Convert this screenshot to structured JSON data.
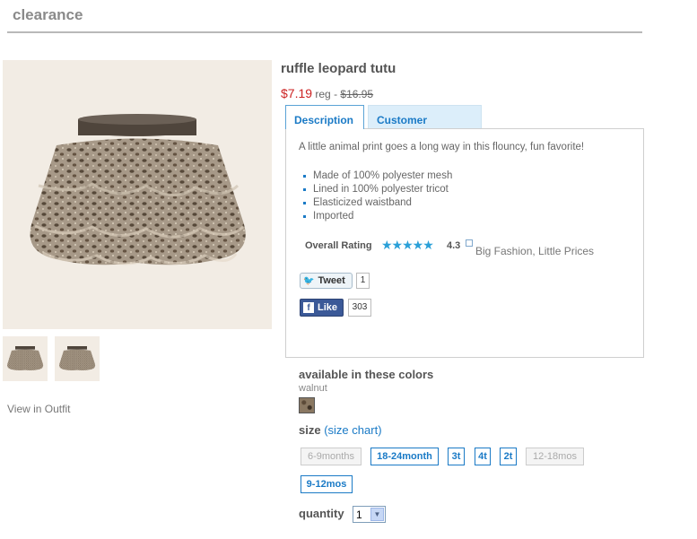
{
  "header": {
    "section_title": "clearance"
  },
  "product": {
    "title": "ruffle leopard tutu",
    "sale_price": "$7.19",
    "reg_label": "reg - ",
    "reg_price": "$16.95"
  },
  "gallery": {
    "view_outfit": "View in Outfit"
  },
  "tabs": [
    {
      "label": "Description",
      "active": true
    },
    {
      "label": "Customer Reviews",
      "active": false
    }
  ],
  "description": {
    "text": "A little animal print goes a long way in this flouncy, fun favorite!",
    "features": [
      "Made of 100% polyester mesh",
      "Lined in 100% polyester tricot",
      "Elasticized waistband",
      "Imported"
    ],
    "rating_label": "Overall Rating",
    "rating_value": "4.3",
    "rating_stars": "★★★★★",
    "tagline": "Big Fashion, Little Prices"
  },
  "social": {
    "tweet_label": "Tweet",
    "tweet_count": "1",
    "like_label": "Like",
    "like_count": "303"
  },
  "colors": {
    "heading": "available in these colors",
    "selected_name": "walnut"
  },
  "size": {
    "heading": "size",
    "open_paren": "(",
    "chart_link": "size chart",
    "close_paren": ")",
    "options": [
      {
        "label": "6-9months",
        "available": false
      },
      {
        "label": "18-24month",
        "available": true
      },
      {
        "label": "3t",
        "available": true
      },
      {
        "label": "4t",
        "available": true
      },
      {
        "label": "2t",
        "available": true
      },
      {
        "label": "12-18mos",
        "available": false
      },
      {
        "label": "9-12mos",
        "available": true
      }
    ]
  },
  "quantity": {
    "label": "quantity",
    "value": "1",
    "arrow": "▼"
  },
  "theme": {
    "accent": "#1a7ac6",
    "sale": "#cc2222",
    "facebook": "#3b5998"
  }
}
